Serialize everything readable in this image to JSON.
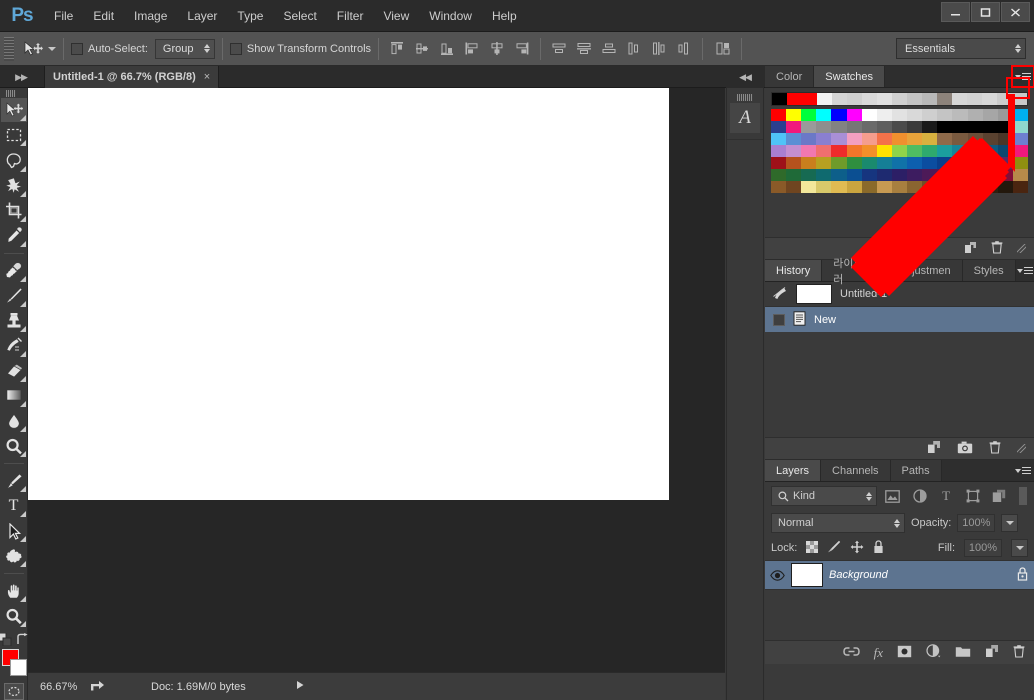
{
  "app": {
    "name": "Ps",
    "logo_color": "#5fa8d8"
  },
  "menubar": {
    "items": [
      "File",
      "Edit",
      "Image",
      "Layer",
      "Type",
      "Select",
      "Filter",
      "View",
      "Window",
      "Help"
    ],
    "window_controls": [
      "minimize",
      "maximize",
      "close"
    ]
  },
  "options_bar": {
    "tool_icon": "move-tool-icon",
    "auto_select_label": "Auto-Select:",
    "auto_select_value": "Group",
    "auto_select_checked": false,
    "show_transform_label": "Show Transform Controls",
    "show_transform_checked": false,
    "align_icons": [
      "align-top-edges-icon",
      "align-vertical-centers-icon",
      "align-bottom-edges-icon",
      "align-left-edges-icon",
      "align-horizontal-centers-icon",
      "align-right-edges-icon"
    ],
    "distribute_icons": [
      "distribute-top-edges-icon",
      "distribute-vertical-centers-icon",
      "distribute-bottom-edges-icon",
      "distribute-left-edges-icon",
      "distribute-horizontal-centers-icon",
      "distribute-right-edges-icon"
    ],
    "extra_icon": "auto-align-layers-icon",
    "workspace": "Essentials"
  },
  "tabbar": {
    "collapse_left_icon": "expand-panels-icon",
    "collapse_right_icon": "collapse-panels-icon",
    "document_tab": "Untitled-1 @ 66.7% (RGB/8)",
    "document_close": "×"
  },
  "toolbar": {
    "tools": [
      {
        "name": "move-tool",
        "selected": true,
        "has_flyout": true
      },
      {
        "name": "rectangular-marquee-tool",
        "selected": false,
        "has_flyout": true
      },
      {
        "name": "lasso-tool",
        "selected": false,
        "has_flyout": true
      },
      {
        "name": "quick-selection-tool",
        "selected": false,
        "has_flyout": true
      },
      {
        "name": "crop-tool",
        "selected": false,
        "has_flyout": true
      },
      {
        "name": "eyedropper-tool",
        "selected": false,
        "has_flyout": true
      },
      {
        "name": "spot-healing-brush-tool",
        "selected": false,
        "has_flyout": true
      },
      {
        "name": "brush-tool",
        "selected": false,
        "has_flyout": true
      },
      {
        "name": "clone-stamp-tool",
        "selected": false,
        "has_flyout": true
      },
      {
        "name": "history-brush-tool",
        "selected": false,
        "has_flyout": true
      },
      {
        "name": "eraser-tool",
        "selected": false,
        "has_flyout": true
      },
      {
        "name": "gradient-tool",
        "selected": false,
        "has_flyout": true
      },
      {
        "name": "blur-tool",
        "selected": false,
        "has_flyout": true
      },
      {
        "name": "dodge-tool",
        "selected": false,
        "has_flyout": true
      },
      {
        "name": "pen-tool",
        "selected": false,
        "has_flyout": true
      },
      {
        "name": "horizontal-type-tool",
        "selected": false,
        "has_flyout": true
      },
      {
        "name": "path-selection-tool",
        "selected": false,
        "has_flyout": true
      },
      {
        "name": "custom-shape-tool",
        "selected": false,
        "has_flyout": true
      },
      {
        "name": "hand-tool",
        "selected": false,
        "has_flyout": true
      },
      {
        "name": "zoom-tool",
        "selected": false,
        "has_flyout": true
      }
    ],
    "default_colors_icon": "default-foreground-background-icon",
    "swap_colors_icon": "swap-foreground-background-icon",
    "foreground_color": "#ff0000",
    "background_color": "#ffffff",
    "quick_mask_icon": "edit-in-quick-mask-icon"
  },
  "canvas": {
    "background_color": "#262626",
    "document_color": "#ffffff"
  },
  "status_bar": {
    "zoom": "66.67%",
    "share_icon": "share-on-behance-icon",
    "doc_info": "Doc: 1.69M/0 bytes",
    "expand_icon": "status-menu-arrow-icon"
  },
  "mini_dock": {
    "collapse_icon": "collapse-to-icons-icon",
    "character_panel_icon": "character-panel-icon",
    "character_glyph": "A"
  },
  "swatches_panel": {
    "tabs": [
      {
        "label": "Color",
        "active": false
      },
      {
        "label": "Swatches",
        "active": true
      }
    ],
    "menu_icon": "panel-menu-icon",
    "menu_highlighted": true,
    "highlight_color": "#ff0000",
    "row_top": [
      "#000000",
      "#ff0000",
      "#ff0000",
      "#f2f2f2",
      "#d4d4d4",
      "#cfcfcf",
      "#d9d9d9",
      "#e0e0e0",
      "#d0d0d0",
      "#c4c4c4",
      "#b9b9b9",
      "#8d837b",
      "#d6d6d6",
      "#d2d2d2",
      "#d8d8d8",
      "#cccccc",
      "#c9c9c9"
    ],
    "grid_rows": [
      [
        "#ff0000",
        "#ffff00",
        "#00ff3c",
        "#00ffff",
        "#0000ff",
        "#ff00ff",
        "#ffffff",
        "#eeeeee",
        "#e2e2e2",
        "#d9d9d9",
        "#cfcfcf",
        "#c4c4c4",
        "#bbbbbb",
        "#b0b0b0",
        "#a6a6a6",
        "#9a9a9a",
        "#00b0f0"
      ],
      [
        "#2b3f8f",
        "#f1197c",
        "#9a9a9a",
        "#8e8e8e",
        "#828282",
        "#767676",
        "#6a6a6a",
        "#5e5e5e",
        "#4b4b4b",
        "#3a3a3a",
        "#1a1a1a",
        "#000000",
        "#000000",
        "#000000",
        "#000000",
        "#000000",
        "#8fd8cd"
      ],
      [
        "#4fc3f7",
        "#5b8fd4",
        "#6b78c7",
        "#8a7fd0",
        "#a98fd6",
        "#f39fc0",
        "#f59d8d",
        "#f4724a",
        "#f0902e",
        "#e8a33a",
        "#d8b13f",
        "#8f6a4a",
        "#7a5a3f",
        "#6a4e38",
        "#5a4230",
        "#4a3628",
        "#6d7fcf"
      ],
      [
        "#a97fd0",
        "#c48fd0",
        "#f178b0",
        "#f06f6f",
        "#ef2b2b",
        "#f2762a",
        "#f28f2a",
        "#ffe300",
        "#8fd44a",
        "#4fbd62",
        "#2eaa6e",
        "#1b9e9e",
        "#16879a",
        "#12708f",
        "#0f5a7f",
        "#0c4870",
        "#f1197c"
      ],
      [
        "#9e1119",
        "#b5521d",
        "#c97f1d",
        "#b7a021",
        "#6f9b2a",
        "#2f8f3f",
        "#1a8a6e",
        "#157f96",
        "#1072a8",
        "#0d5fae",
        "#0b4da0",
        "#0a3f8c",
        "#2a2f82",
        "#3b2a7a",
        "#4a2a70",
        "#5a2a66",
        "#8f8f10"
      ],
      [
        "#2f6a2a",
        "#1f6a38",
        "#166a52",
        "#0f6a6f",
        "#0d5f8a",
        "#0b4f92",
        "#16357f",
        "#1e2a70",
        "#2c1f66",
        "#3d1c60",
        "#4d1a58",
        "#5a1850",
        "#66164a",
        "#701444",
        "#7a123e",
        "#820f38",
        "#b78a4a"
      ],
      [
        "#8a5a28",
        "#6f4520",
        "#f2e79a",
        "#d8c96a",
        "#e0bb52",
        "#caa53f",
        "#8a6a2a",
        "#c79a52",
        "#a87f3f",
        "#8a6530",
        "#6f5026",
        "#5a4020",
        "#4a3419",
        "#3c2a14",
        "#2f2010",
        "#23180c",
        "#4a2510"
      ]
    ],
    "edge_column": [
      "#00b0f0",
      "#8fd8cd",
      "#6d7fcf",
      "#f1197c",
      "#8f8f10",
      "#b78a4a",
      "#4a2510"
    ],
    "bottom_icons": [
      "new-swatch-icon",
      "delete-swatch-icon",
      "panel-resize-grip"
    ]
  },
  "history_panel": {
    "tabs": [
      {
        "label": "History",
        "active": true
      },
      {
        "label": "라이브러러",
        "active": false
      },
      {
        "label": "Adjustmen",
        "active": false
      },
      {
        "label": "Styles",
        "active": false
      }
    ],
    "menu_icon": "panel-menu-icon",
    "snapshot": {
      "icon": "history-brush-source-icon",
      "label": "Untitled-1"
    },
    "states": [
      {
        "icon": "new-document-icon",
        "label": "New",
        "active": true
      }
    ],
    "footer_icons": [
      "create-document-from-state-icon",
      "create-new-snapshot-icon",
      "delete-state-icon",
      "panel-resize-grip"
    ]
  },
  "layers_panel": {
    "tabs": [
      {
        "label": "Layers",
        "active": true
      },
      {
        "label": "Channels",
        "active": false
      },
      {
        "label": "Paths",
        "active": false
      }
    ],
    "menu_icon": "panel-menu-icon",
    "filter_kind": "Kind",
    "filter_icons": [
      "filter-pixel-layers-icon",
      "filter-adjustment-layers-icon",
      "filter-type-layers-icon",
      "filter-shape-layers-icon",
      "filter-smart-objects-icon"
    ],
    "filter_toggle": "filter-enable-toggle",
    "blend_mode": "Normal",
    "opacity_label": "Opacity:",
    "opacity_value": "100%",
    "lock_label": "Lock:",
    "lock_icons": [
      "lock-transparent-pixels-icon",
      "lock-image-pixels-icon",
      "lock-position-icon",
      "lock-all-icon"
    ],
    "fill_label": "Fill:",
    "fill_value": "100%",
    "layers": [
      {
        "name": "Background",
        "visible": true,
        "locked": true,
        "selected": true,
        "visibility_icon": "eye-icon",
        "lock_icon": "lock-icon"
      }
    ],
    "footer_icons": [
      "link-layers-icon",
      "add-layer-style-icon",
      "add-layer-mask-icon",
      "new-fill-adjustment-layer-icon",
      "new-group-icon",
      "new-layer-icon",
      "delete-layer-icon"
    ]
  },
  "annotation": {
    "arrow_color": "#ff0000",
    "arrow_target": "swatches-panel-menu-button",
    "highlight_box_color": "#ff0000"
  }
}
